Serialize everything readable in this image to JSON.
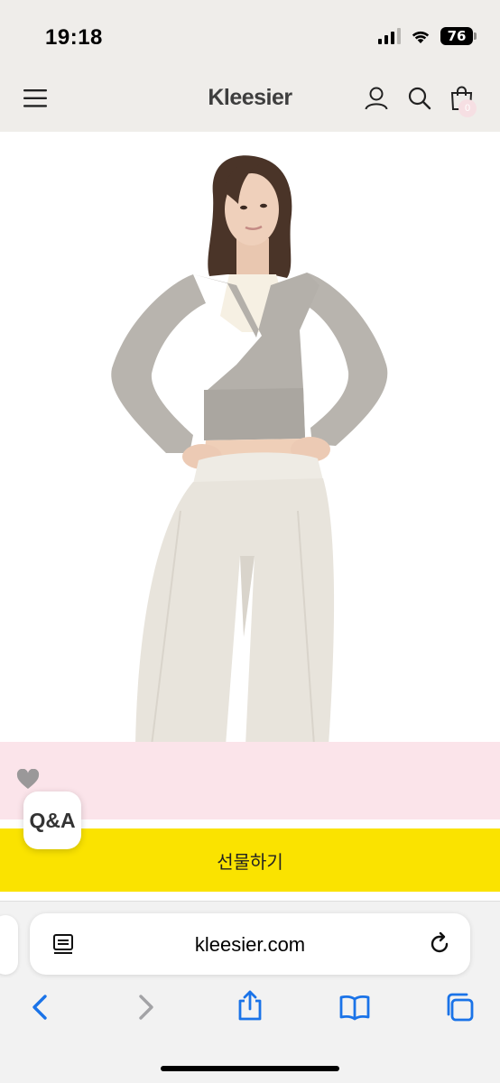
{
  "status_bar": {
    "time": "19:18",
    "battery": "76",
    "icons": [
      "signal-icon",
      "wifi-icon",
      "battery-icon"
    ]
  },
  "header": {
    "brand": "Kleesier",
    "icons": [
      "menu-icon",
      "user-icon",
      "search-icon",
      "shopping-bag-icon"
    ],
    "cart_count": "0"
  },
  "product": {
    "image_alt": "model wearing grey wrap cardigan and white sweatpants",
    "wishlist_icon": "heart-icon"
  },
  "buttons": {
    "qa_label": "Q&A",
    "gift_label": "선물하기"
  },
  "colors": {
    "header_bg": "#efedea",
    "band_pink": "#fbe4ea",
    "gift_yellow": "#fae300",
    "safari_blue": "#1a73e8"
  },
  "browser": {
    "url": "kleesier.com",
    "toolbar_icons": [
      "back-icon",
      "forward-icon",
      "share-icon",
      "bookmarks-icon",
      "tabs-icon"
    ]
  }
}
